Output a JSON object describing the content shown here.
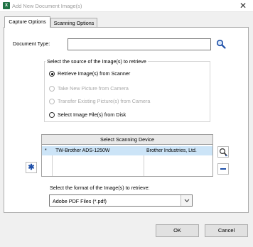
{
  "window": {
    "title": "Add New Document Image(s)",
    "close_glyph": "✕"
  },
  "tabs": [
    {
      "label": "Capture Options",
      "active": true
    },
    {
      "label": "Scanning Options",
      "active": false
    }
  ],
  "document_type": {
    "label": "Document Type:",
    "value": ""
  },
  "source_group": {
    "legend": "Select the source of the Image(s) to retrieve",
    "options": [
      {
        "label": "Retrieve Image(s) from Scanner",
        "checked": true,
        "enabled": true
      },
      {
        "label": "Take New Picture from Camera",
        "checked": false,
        "enabled": false
      },
      {
        "label": "Transfer Existing Picture(s) from Camera",
        "checked": false,
        "enabled": false
      },
      {
        "label": "Select Image File(s) from Disk",
        "checked": false,
        "enabled": true
      }
    ]
  },
  "scanning_device": {
    "header": "Select Scanning Device",
    "rows": [
      {
        "marker": "*",
        "name": "TW-Brother ADS-1250W",
        "manufacturer": "Brother Industries, Ltd."
      }
    ]
  },
  "format": {
    "label": "Select the format of the Image(s) to retrieve:",
    "selected": "Adobe PDF Files (*.pdf)"
  },
  "buttons": {
    "ok": "OK",
    "cancel": "Cancel"
  },
  "icons": {
    "app": "X",
    "add_device": "✱",
    "remove_device": "−",
    "dropdown": "⌄"
  },
  "colors": {
    "accent_blue": "#1e4fa8",
    "selection": "#cce4f7",
    "app_icon": "#217346"
  }
}
